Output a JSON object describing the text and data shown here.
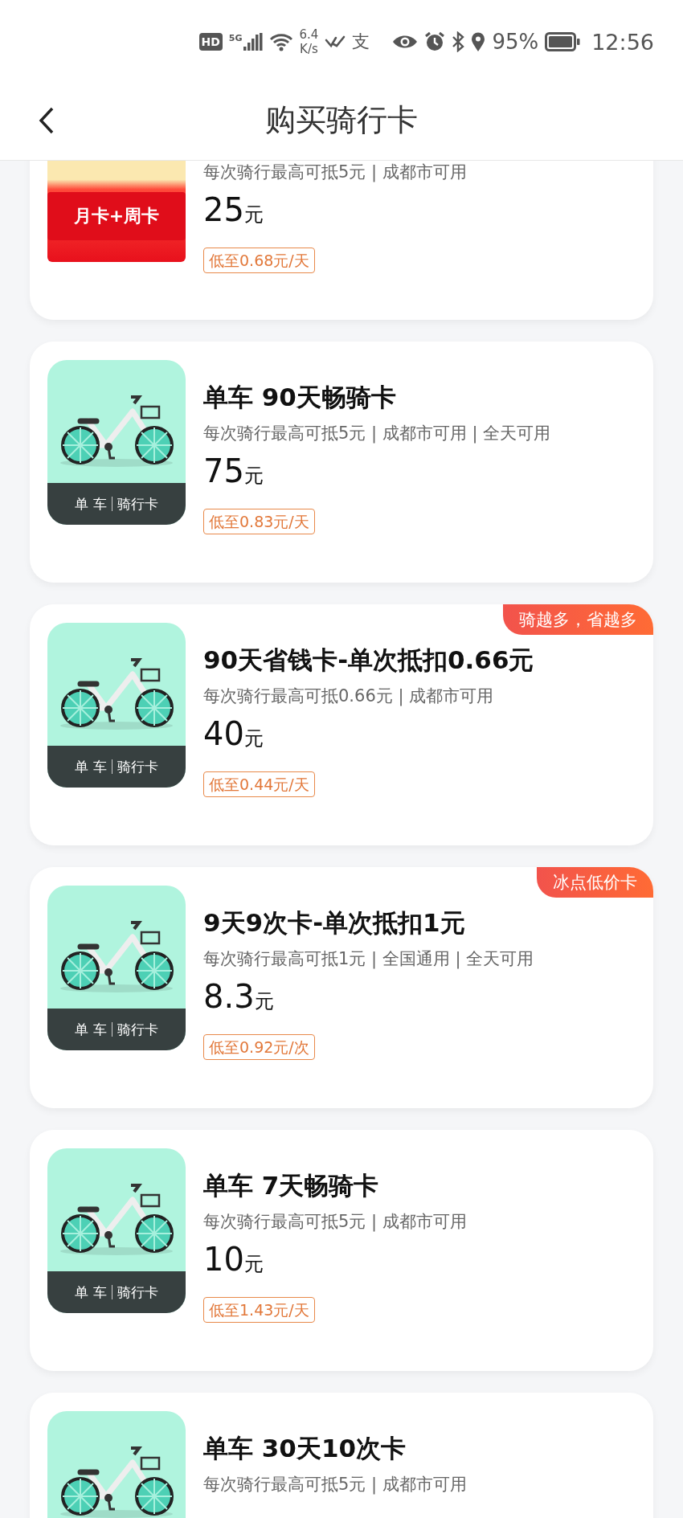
{
  "status_bar": {
    "hd": "HD",
    "network": "5G",
    "speed_value": "6.4",
    "speed_unit": "K/s",
    "app_glyph": "支",
    "battery": "95%",
    "time": "12:56"
  },
  "nav": {
    "title": "购买骑行卡"
  },
  "cards": [
    {
      "kind": "envelope",
      "tile_text": "月卡+周卡",
      "description": "每次骑行最高可抵5元 | 成都市可用",
      "price": "25",
      "unit": "元",
      "per_day": "低至0.68元/天"
    },
    {
      "kind": "bike",
      "tile_brand": "单 车",
      "tile_type": "骑行卡",
      "title": "单车 90天畅骑卡",
      "description": "每次骑行最高可抵5元 | 成都市可用 | 全天可用",
      "price": "75",
      "unit": "元",
      "per_day": "低至0.83元/天"
    },
    {
      "kind": "bike",
      "tile_brand": "单 车",
      "tile_type": "骑行卡",
      "badge": "骑越多，省越多",
      "title": "90天省钱卡-单次抵扣0.66元",
      "description": "每次骑行最高可抵0.66元 | 成都市可用",
      "price": "40",
      "unit": "元",
      "per_day": "低至0.44元/天"
    },
    {
      "kind": "bike",
      "tile_brand": "单 车",
      "tile_type": "骑行卡",
      "badge": "冰点低价卡",
      "title": "9天9次卡-单次抵扣1元",
      "description": "每次骑行最高可抵1元 | 全国通用 | 全天可用",
      "price": "8.3",
      "unit": "元",
      "per_day": "低至0.92元/次"
    },
    {
      "kind": "bike",
      "tile_brand": "单 车",
      "tile_type": "骑行卡",
      "title": "单车 7天畅骑卡",
      "description": "每次骑行最高可抵5元 | 成都市可用",
      "price": "10",
      "unit": "元",
      "per_day": "低至1.43元/天"
    },
    {
      "kind": "bike",
      "title": "单车 30天10次卡",
      "description": "每次骑行最高可抵5元 | 成都市可用"
    }
  ]
}
